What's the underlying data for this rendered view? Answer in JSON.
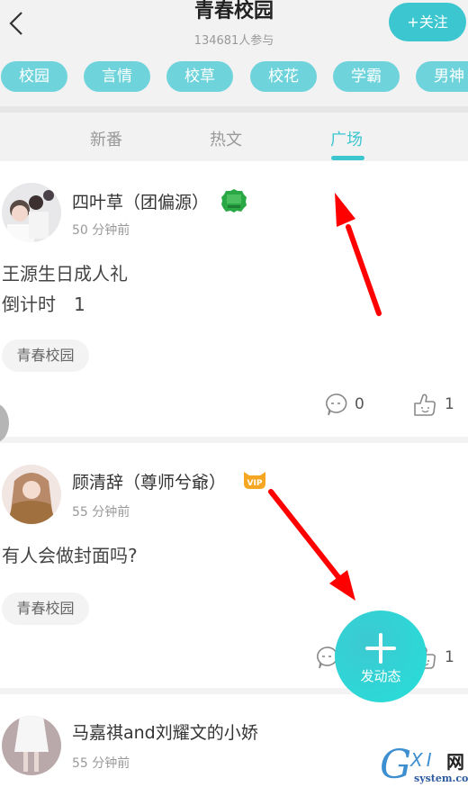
{
  "header": {
    "title": "青春校园",
    "subtitle": "134681人参与",
    "follow_label": "+关注"
  },
  "tags": [
    "校园",
    "言情",
    "校草",
    "校花",
    "学霸",
    "男神"
  ],
  "tabs": [
    {
      "label": "新番",
      "active": false
    },
    {
      "label": "热文",
      "active": false
    },
    {
      "label": "广场",
      "active": true
    }
  ],
  "posts": [
    {
      "username": "四叶草（团偏源）",
      "badge": "green-medal",
      "time": "50 分钟前",
      "content": "王源生日成人礼\n倒计时　1",
      "topic": "青春校园",
      "comments": "0",
      "likes": "1"
    },
    {
      "username": "顾清辞（尊师兮爺）",
      "badge": "VIP",
      "time": "55 分钟前",
      "content": "有人会做封面吗?",
      "topic": "青春校园",
      "comments": "",
      "likes": "1"
    },
    {
      "username": "马嘉祺and刘耀文的小娇",
      "time": "55 分钟前"
    }
  ],
  "fab": {
    "label": "发动态"
  },
  "watermark": {
    "g": "G",
    "xi": "XI",
    "net": "网",
    "domain": "system.com"
  },
  "colors": {
    "accent": "#3cc6d0",
    "tag_pill": "#6fd3db",
    "arrow": "#ff0000",
    "vip": "#f5a623"
  }
}
